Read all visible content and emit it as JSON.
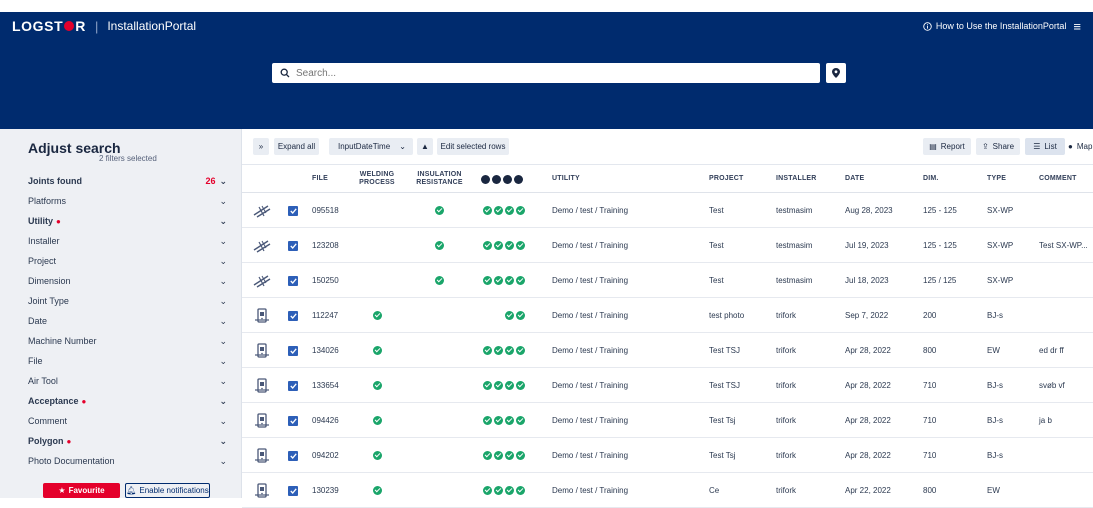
{
  "header": {
    "brand_left": "LOGST",
    "brand_right": "R",
    "separator": "|",
    "app_name": "InstallationPortal",
    "help_link": "How to Use the InstallationPortal",
    "icons": {
      "info": "info-icon",
      "menu": "hamburger-menu-icon"
    }
  },
  "search": {
    "placeholder": "Search...",
    "value": ""
  },
  "sidebar": {
    "title": "Adjust search",
    "subtitle": "2 filters selected",
    "joints_found_label": "Joints found",
    "joints_found_count": "26",
    "filters": [
      {
        "label": "Platforms",
        "required": false
      },
      {
        "label": "Utility",
        "required": true
      },
      {
        "label": "Installer",
        "required": false
      },
      {
        "label": "Project",
        "required": false
      },
      {
        "label": "Dimension",
        "required": false
      },
      {
        "label": "Joint Type",
        "required": false
      },
      {
        "label": "Date",
        "required": false
      },
      {
        "label": "Machine Number",
        "required": false
      },
      {
        "label": "File",
        "required": false
      },
      {
        "label": "Air Tool",
        "required": false
      },
      {
        "label": "Acceptance",
        "required": true
      },
      {
        "label": "Comment",
        "required": false
      },
      {
        "label": "Polygon",
        "required": true
      },
      {
        "label": "Photo Documentation",
        "required": false
      }
    ],
    "favourite_label": "Favourite",
    "notifications_label": "Enable notifications"
  },
  "toolbar": {
    "expand_all": "Expand all",
    "sort_field": "InputDateTime",
    "edit_rows": "Edit selected rows",
    "report": "Report",
    "share": "Share",
    "list": "List",
    "map": "Map"
  },
  "table": {
    "columns": {
      "file": "FILE",
      "welding_1": "WELDING",
      "welding_2": "PROCESS",
      "insulation_1": "INSULATION",
      "insulation_2": "RESISTANCE",
      "utility": "UTILITY",
      "project": "PROJECT",
      "installer": "INSTALLER",
      "date": "DATE",
      "dim": "DIM.",
      "type": "TYPE",
      "comment": "COMMENT"
    },
    "rows": [
      {
        "icon": "pipe-joint-icon",
        "file": "095518",
        "welding": false,
        "insulation": true,
        "checks": 4,
        "utility": "Demo / test / Training",
        "project": "Test",
        "installer": "testmasim",
        "date": "Aug 28, 2023",
        "dim": "125 - 125",
        "type": "SX-WP",
        "comment": ""
      },
      {
        "icon": "pipe-joint-icon",
        "file": "123208",
        "welding": false,
        "insulation": true,
        "checks": 4,
        "utility": "Demo / test / Training",
        "project": "Test",
        "installer": "testmasim",
        "date": "Jul 19, 2023",
        "dim": "125 - 125",
        "type": "SX-WP",
        "comment": "Test SX-WP..."
      },
      {
        "icon": "pipe-joint-icon",
        "file": "150250",
        "welding": false,
        "insulation": true,
        "checks": 4,
        "utility": "Demo / test / Training",
        "project": "Test",
        "installer": "testmasim",
        "date": "Jul 18, 2023",
        "dim": "125 / 125",
        "type": "SX-WP",
        "comment": ""
      },
      {
        "icon": "machine-icon",
        "file": "112247",
        "welding": true,
        "insulation": false,
        "checks": 2,
        "utility": "Demo / test / Training",
        "project": "test photo",
        "installer": "trifork",
        "date": "Sep 7, 2022",
        "dim": "200",
        "type": "BJ-s",
        "comment": ""
      },
      {
        "icon": "machine-icon",
        "file": "134026",
        "welding": true,
        "insulation": false,
        "checks": 4,
        "utility": "Demo / test / Training",
        "project": "Test TSJ",
        "installer": "trifork",
        "date": "Apr 28, 2022",
        "dim": "800",
        "type": "EW",
        "comment": "ed dr ff"
      },
      {
        "icon": "machine-icon",
        "file": "133654",
        "welding": true,
        "insulation": false,
        "checks": 4,
        "utility": "Demo / test / Training",
        "project": "Test TSJ",
        "installer": "trifork",
        "date": "Apr 28, 2022",
        "dim": "710",
        "type": "BJ-s",
        "comment": "svøb vf"
      },
      {
        "icon": "machine-icon",
        "file": "094426",
        "welding": true,
        "insulation": false,
        "checks": 4,
        "utility": "Demo / test / Training",
        "project": "Test Tsj",
        "installer": "trifork",
        "date": "Apr 28, 2022",
        "dim": "710",
        "type": "BJ-s",
        "comment": "ja b"
      },
      {
        "icon": "machine-icon",
        "file": "094202",
        "welding": true,
        "insulation": false,
        "checks": 4,
        "utility": "Demo / test / Training",
        "project": "Test Tsj",
        "installer": "trifork",
        "date": "Apr 28, 2022",
        "dim": "710",
        "type": "BJ-s",
        "comment": ""
      },
      {
        "icon": "machine-icon",
        "file": "130239",
        "welding": true,
        "insulation": false,
        "checks": 4,
        "utility": "Demo / test / Training",
        "project": "Ce",
        "installer": "trifork",
        "date": "Apr 22, 2022",
        "dim": "800",
        "type": "EW",
        "comment": ""
      }
    ]
  },
  "colors": {
    "navy": "#002b6e",
    "accent_red": "#e4002b",
    "ok_green": "#1aa56a",
    "checkbox_blue": "#2d5fb8"
  }
}
